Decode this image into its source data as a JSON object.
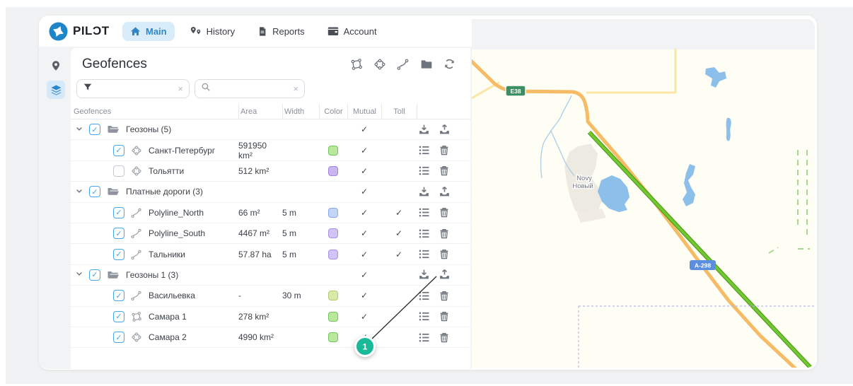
{
  "brand": {
    "logo_text": "PILƆT"
  },
  "nav": {
    "tabs": [
      {
        "label": "Main",
        "icon": "home-icon",
        "active": true
      },
      {
        "label": "History",
        "icon": "history-icon",
        "active": false
      },
      {
        "label": "Reports",
        "icon": "reports-icon",
        "active": false
      },
      {
        "label": "Account",
        "icon": "account-icon",
        "active": false
      }
    ]
  },
  "sidebar": {
    "items": [
      {
        "icon": "map-pin-icon",
        "active": false
      },
      {
        "icon": "layers-icon",
        "active": true
      }
    ]
  },
  "panel": {
    "title": "Geofences",
    "toolbar": [
      {
        "icon": "draw-polygon-icon"
      },
      {
        "icon": "draw-circle-icon"
      },
      {
        "icon": "draw-polyline-icon"
      },
      {
        "icon": "folder-icon"
      },
      {
        "icon": "refresh-icon"
      }
    ],
    "filter_input": {
      "value": "",
      "placeholder": "",
      "icon": "filter-icon"
    },
    "search_input": {
      "value": "",
      "placeholder": "",
      "icon": "search-icon"
    },
    "table": {
      "columns": [
        "Geofences",
        "Area",
        "Width",
        "Color",
        "Mutual",
        "Toll"
      ],
      "rows": [
        {
          "kind": "group",
          "name": "Геозоны (5)",
          "checked": true,
          "shape": "folder-open-icon",
          "area": "",
          "width": "",
          "color": null,
          "mutual": true,
          "toll": false,
          "actions": [
            "import-icon",
            "export-icon"
          ]
        },
        {
          "kind": "item",
          "name": "Санкт-Петербург",
          "checked": true,
          "shape": "circle-icon",
          "area": "591950 km²",
          "width": "",
          "color": {
            "fill": "#b9e89d",
            "border": "#6fc45f"
          },
          "mutual": true,
          "toll": false,
          "actions": [
            "details-icon",
            "trash-icon"
          ]
        },
        {
          "kind": "item",
          "name": "Тольятти",
          "checked": false,
          "shape": "circle-icon",
          "area": "512 km²",
          "width": "",
          "color": {
            "fill": "#cbb5f0",
            "border": "#a583e6"
          },
          "mutual": true,
          "toll": false,
          "actions": [
            "details-icon",
            "trash-icon"
          ]
        },
        {
          "kind": "group",
          "name": "Платные дороги (3)",
          "checked": true,
          "shape": "folder-open-icon",
          "area": "",
          "width": "",
          "color": null,
          "mutual": true,
          "toll": false,
          "actions": [
            "import-icon",
            "export-icon"
          ]
        },
        {
          "kind": "item",
          "name": "Polyline_North",
          "checked": true,
          "shape": "polyline-icon",
          "area": "66 m²",
          "width": "5 m",
          "color": {
            "fill": "#c3d6f8",
            "border": "#86a8ec"
          },
          "mutual": true,
          "toll": true,
          "actions": [
            "details-icon",
            "trash-icon"
          ]
        },
        {
          "kind": "item",
          "name": "Polyline_South",
          "checked": true,
          "shape": "polyline-icon",
          "area": "4467 m²",
          "width": "5 m",
          "color": {
            "fill": "#d2c3f4",
            "border": "#a98fe8"
          },
          "mutual": true,
          "toll": true,
          "actions": [
            "details-icon",
            "trash-icon"
          ]
        },
        {
          "kind": "item",
          "name": "Тальники",
          "checked": true,
          "shape": "polyline-icon",
          "area": "57.87 ha",
          "width": "5 m",
          "color": {
            "fill": "#d2c3f4",
            "border": "#a98fe8"
          },
          "mutual": true,
          "toll": true,
          "actions": [
            "details-icon",
            "trash-icon"
          ]
        },
        {
          "kind": "group",
          "name": "Геозоны 1 (3)",
          "checked": true,
          "shape": "folder-open-icon",
          "area": "",
          "width": "",
          "color": null,
          "mutual": true,
          "toll": false,
          "actions": [
            "import-icon",
            "export-icon"
          ]
        },
        {
          "kind": "item",
          "name": "Васильевка",
          "checked": true,
          "shape": "polyline-icon",
          "area": "-",
          "width": "30 m",
          "color": {
            "fill": "#d9e9a8",
            "border": "#b2cb72"
          },
          "mutual": true,
          "toll": false,
          "actions": [
            "details-icon",
            "trash-icon"
          ]
        },
        {
          "kind": "item",
          "name": "Самара 1",
          "checked": true,
          "shape": "polygon-icon",
          "area": "278 km²",
          "width": "",
          "color": {
            "fill": "#b9e89d",
            "border": "#6fc45f"
          },
          "mutual": true,
          "toll": false,
          "actions": [
            "details-icon",
            "trash-icon"
          ]
        },
        {
          "kind": "item",
          "name": "Самара 2",
          "checked": true,
          "shape": "circle-icon",
          "area": "4990 km²",
          "width": "",
          "color": {
            "fill": "#b9e89d",
            "border": "#6fc45f"
          },
          "mutual": true,
          "toll": false,
          "actions": [
            "details-icon",
            "trash-icon"
          ]
        }
      ]
    }
  },
  "map": {
    "road_badge_1": "E38",
    "road_badge_2": "A-298",
    "place_line1": "Novy",
    "place_line2": "Новый",
    "colors": {
      "tiles": "#fffef4",
      "road_trunk": "#f5bb66",
      "road_minor": "#fae7a6",
      "route_green": "#72c832",
      "water": "#8cbfe9",
      "badge_e_bg": "#3d8f63",
      "badge_a_bg": "#5b8ede"
    }
  },
  "callout": {
    "label": "1",
    "color": "#19b99a"
  }
}
